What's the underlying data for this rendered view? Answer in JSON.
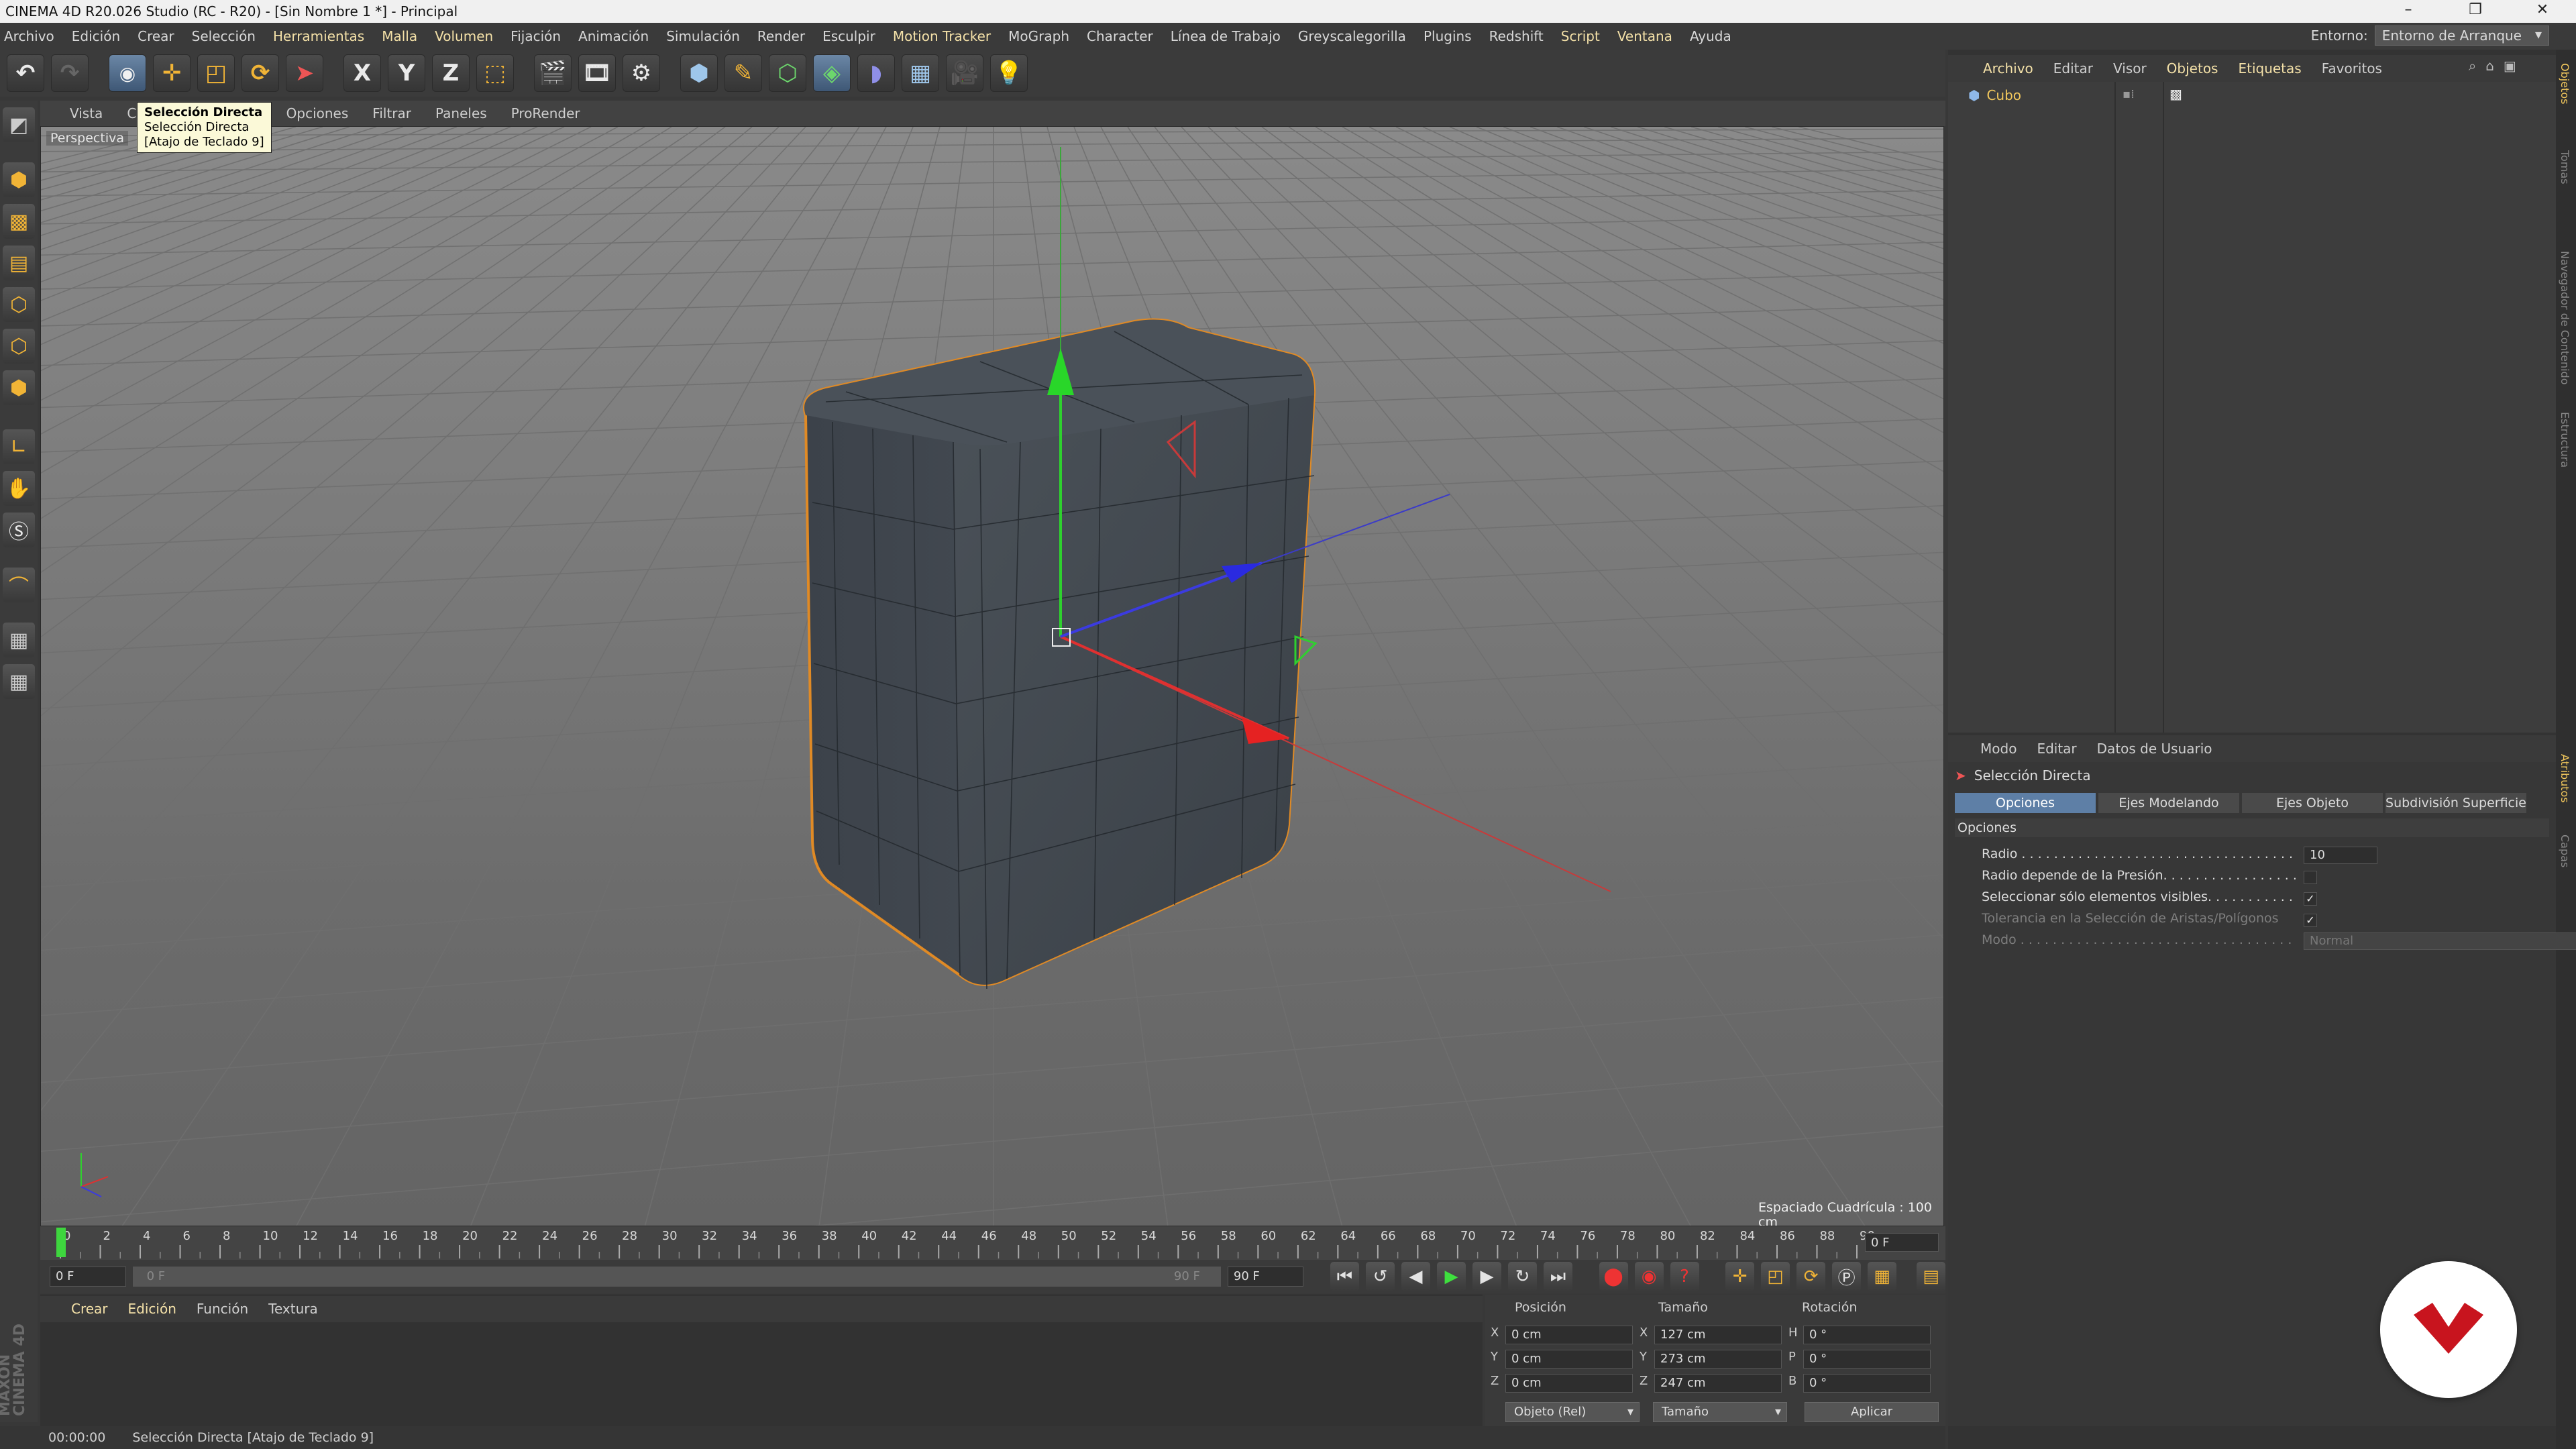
{
  "window": {
    "title": "CINEMA 4D R20.026 Studio (RC - R20) - [Sin Nombre 1 *] - Principal",
    "min": "–",
    "max": "❐",
    "close": "✕"
  },
  "menu": {
    "items": [
      "Archivo",
      "Edición",
      "Crear",
      "Selección",
      "Herramientas",
      "Malla",
      "Volumen",
      "Fijación",
      "Animación",
      "Simulación",
      "Render",
      "Esculpir",
      "Motion Tracker",
      "MoGraph",
      "Character",
      "Línea de Trabajo",
      "Greyscalegorilla",
      "Plugins",
      "Redshift",
      "Script",
      "Ventana",
      "Ayuda"
    ],
    "highlighted": [
      "Herramientas",
      "Malla",
      "Volumen",
      "Motion Tracker",
      "Script",
      "Ventana"
    ],
    "env_label": "Entorno:",
    "env_value": "Entorno de Arranque"
  },
  "toolbar": {
    "x_label": "X",
    "y_label": "Y",
    "z_label": "Z"
  },
  "viewport": {
    "menu": [
      "Vista",
      "Cámaras",
      "Mostrar",
      "Opciones",
      "Filtrar",
      "Paneles",
      "ProRender"
    ],
    "perspective": "Perspectiva",
    "grid_spacing": "Espaciado Cuadrícula : 100 cm",
    "tooltip": [
      "Selección Directa",
      "Selección Directa",
      "[Atajo de Teclado 9]"
    ]
  },
  "timeline": {
    "ticks": [
      "0",
      "2",
      "4",
      "6",
      "8",
      "10",
      "12",
      "14",
      "16",
      "18",
      "20",
      "22",
      "24",
      "26",
      "28",
      "30",
      "32",
      "34",
      "36",
      "38",
      "40",
      "42",
      "44",
      "46",
      "48",
      "50",
      "52",
      "54",
      "56",
      "58",
      "60",
      "62",
      "64",
      "66",
      "68",
      "70",
      "72",
      "74",
      "76",
      "78",
      "80",
      "82",
      "84",
      "86",
      "88",
      "90"
    ],
    "frame_end_label": "0 F",
    "start": "0 F",
    "range_start": "0 F",
    "range_end": "90 F",
    "end": "90 F"
  },
  "material": {
    "menu": [
      "Crear",
      "Edición",
      "Función",
      "Textura"
    ],
    "highlighted": [
      "Crear",
      "Edición"
    ],
    "brand_line1": "MAXON",
    "brand_line2": "CINEMA 4D"
  },
  "coords": {
    "headers": [
      "Posición",
      "Tamaño",
      "Rotación"
    ],
    "rows": [
      {
        "a": "X",
        "pos": "0 cm",
        "b": "X",
        "size": "127 cm",
        "c": "H",
        "rot": "0 °"
      },
      {
        "a": "Y",
        "pos": "0 cm",
        "b": "Y",
        "size": "273 cm",
        "c": "P",
        "rot": "0 °"
      },
      {
        "a": "Z",
        "pos": "0 cm",
        "b": "Z",
        "size": "247 cm",
        "c": "B",
        "rot": "0 °"
      }
    ],
    "mode": "Objeto (Rel)",
    "size_mode": "Tamaño",
    "apply": "Aplicar"
  },
  "status": {
    "time": "00:00:00",
    "message": "Selección Directa [Atajo de Teclado 9]"
  },
  "objects": {
    "menu": [
      "Archivo",
      "Editar",
      "Visor",
      "Objetos",
      "Etiquetas",
      "Favoritos"
    ],
    "highlighted": [
      "Archivo",
      "Objetos",
      "Etiquetas"
    ],
    "item": "Cubo"
  },
  "side_tabs": [
    "Objetos",
    "Tomas",
    "Navegador de Contenido",
    "Estructura",
    "Atributos",
    "Capas"
  ],
  "attributes": {
    "menu": [
      "Modo",
      "Editar",
      "Datos de Usuario"
    ],
    "title": "Selección Directa",
    "tabs": [
      "Opciones",
      "Ejes Modelando",
      "Ejes Objeto",
      "Subdivisión Superficie"
    ],
    "section": "Opciones",
    "rows": [
      {
        "label": "Radio . . . . . . . . . . . . . . . . . . . . . . . . . . . . . . . . . . . . . . . . .",
        "value": "10"
      },
      {
        "label": "Radio depende de la Presión. . . . . . . . . . . . . . . . . . . . . . . . . .",
        "value": ""
      },
      {
        "label": "Seleccionar sólo elementos visibles. . . . . . . . . . . . . . . . . . .",
        "value": "✓"
      },
      {
        "label": "Tolerancia en la Selección de Aristas/Polígonos",
        "value": "✓"
      },
      {
        "label": "Modo . . . . . . . . . . . . . . . . . . . . . . . . . . . . . . . . . . . . . . . .",
        "value": "Normal"
      }
    ]
  }
}
